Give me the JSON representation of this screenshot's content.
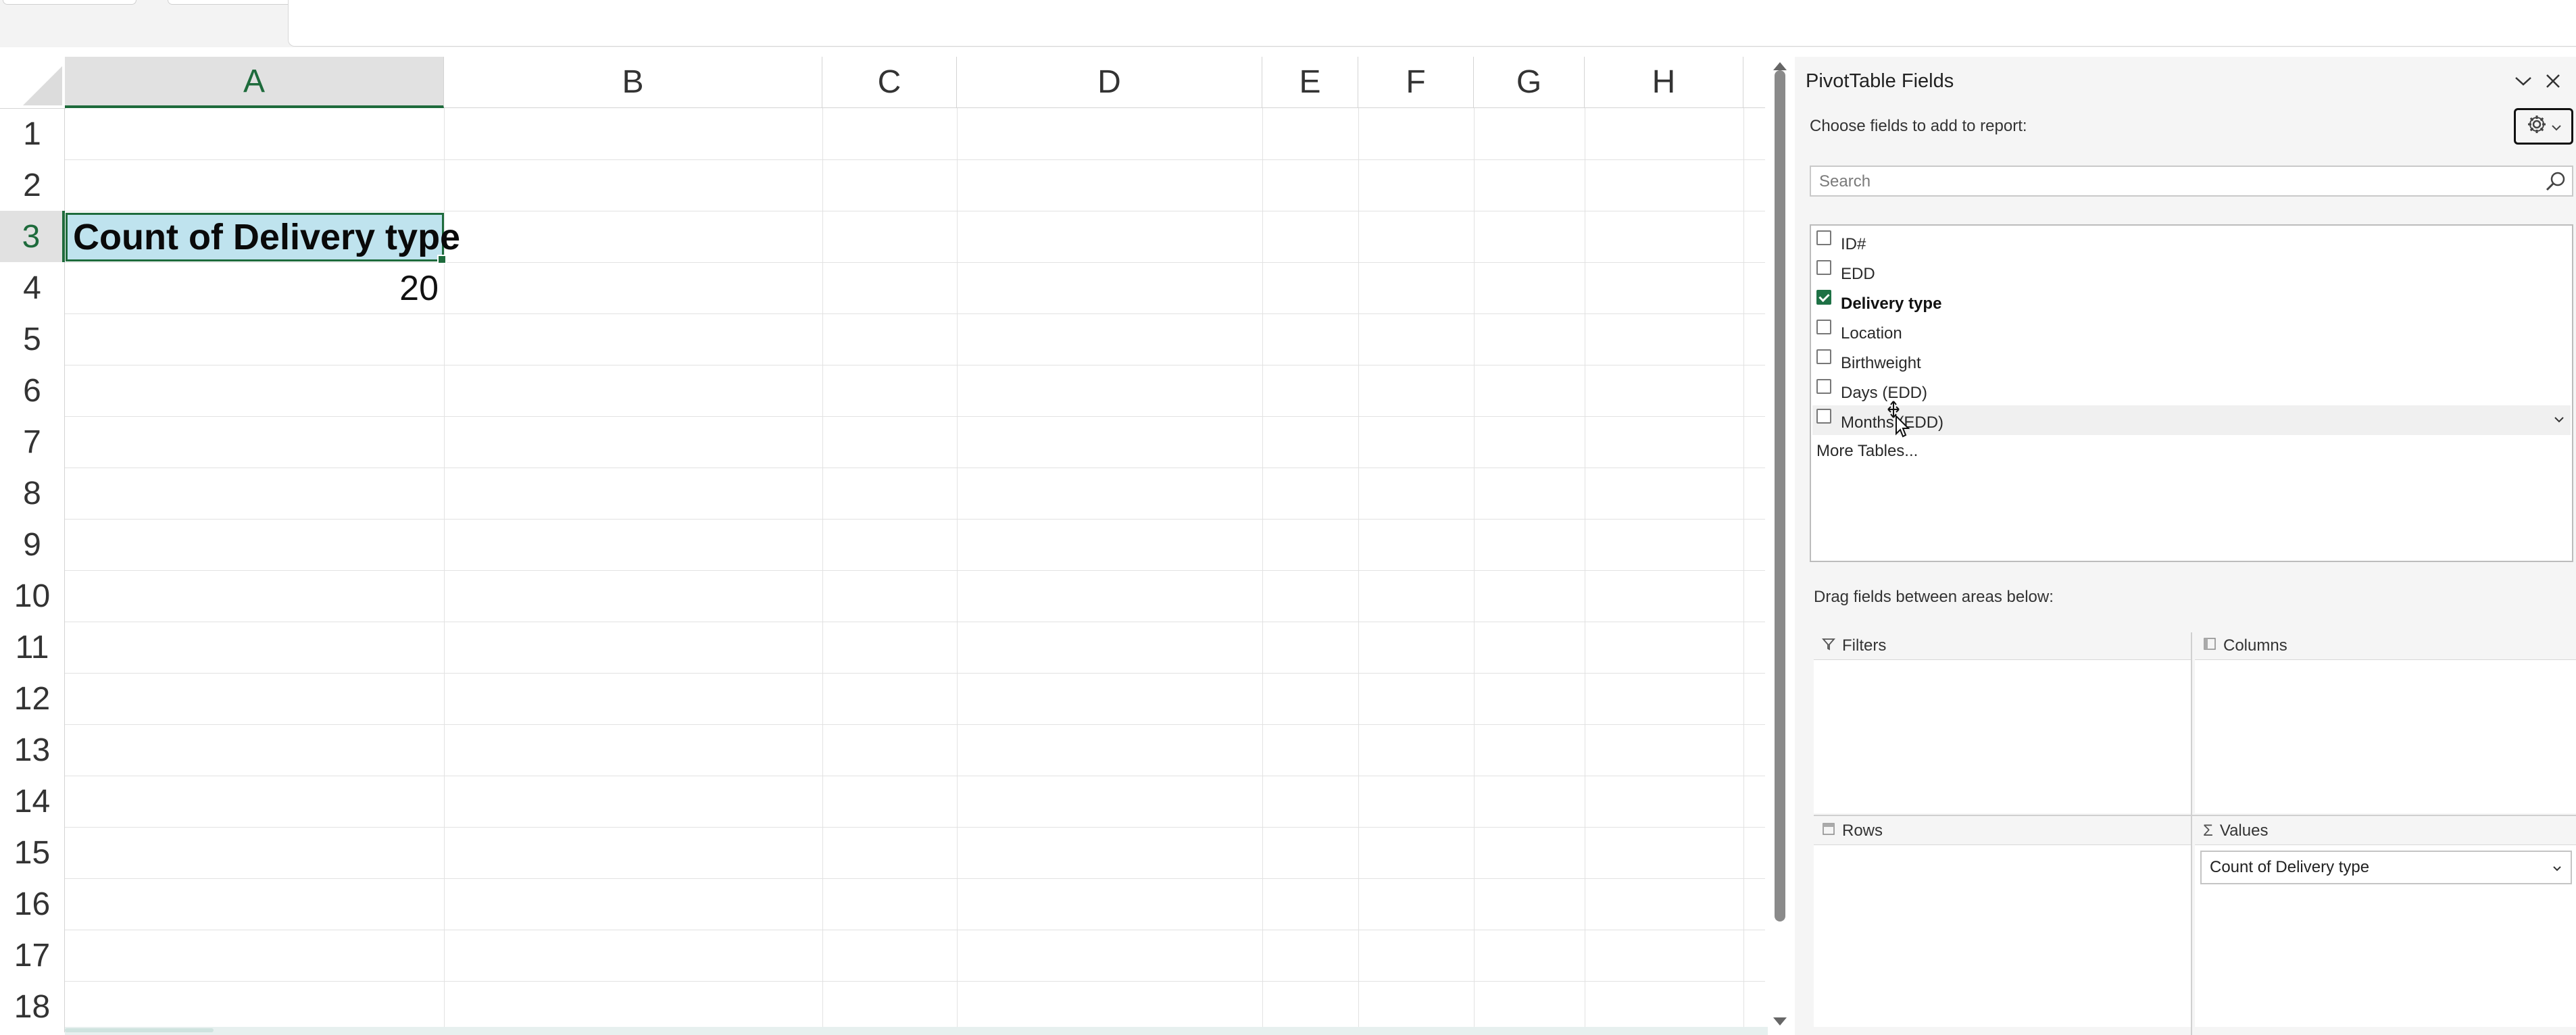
{
  "grid": {
    "columns": [
      "A",
      "B",
      "C",
      "D",
      "E",
      "F",
      "G",
      "H"
    ],
    "selected_column": "A",
    "rows": [
      "1",
      "2",
      "3",
      "4",
      "5",
      "6",
      "7",
      "8",
      "9",
      "10",
      "11",
      "12",
      "13",
      "14",
      "15",
      "16",
      "17",
      "18"
    ],
    "selected_row": "3",
    "cells": {
      "A3": "Count of Delivery type",
      "A4": "20"
    }
  },
  "pivot_pane": {
    "title": "PivotTable Fields",
    "choose_label": "Choose fields to add to report:",
    "search_placeholder": "Search",
    "fields": [
      {
        "label": "ID#",
        "checked": false
      },
      {
        "label": "EDD",
        "checked": false
      },
      {
        "label": "Delivery type",
        "checked": true
      },
      {
        "label": "Location",
        "checked": false
      },
      {
        "label": "Birthweight",
        "checked": false
      },
      {
        "label": "Days (EDD)",
        "checked": false
      },
      {
        "label": "Months (EDD)",
        "checked": false
      }
    ],
    "more_tables": "More Tables...",
    "drag_hint": "Drag fields between areas below:",
    "areas": {
      "filters": "Filters",
      "columns": "Columns",
      "rows": "Rows",
      "values": "Values",
      "values_items": [
        "Count of Delivery type"
      ]
    },
    "icons": {
      "collapse": "chevron-down-icon",
      "close": "close-icon",
      "settings": "gear-icon",
      "search": "search-icon",
      "filter": "filter-icon",
      "columns": "columns-icon",
      "rows": "rows-icon",
      "values": "sigma-icon"
    }
  },
  "colors": {
    "accent_green": "#1e6b3c",
    "checkbox_green": "#1e7145",
    "selected_cell_fill": "#bfe3ee"
  }
}
